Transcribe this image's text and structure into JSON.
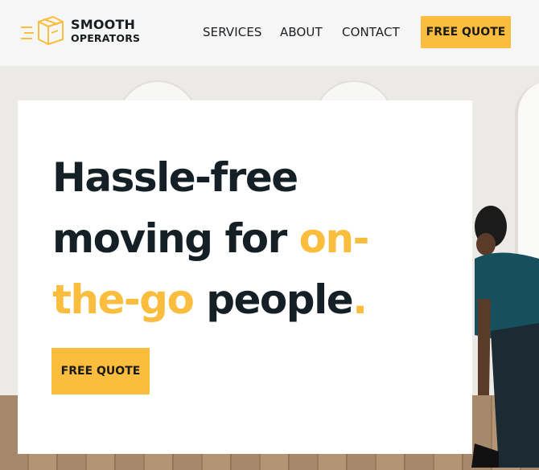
{
  "header": {
    "logo": {
      "line1": "SMOOTH",
      "line2": "OPERATORS",
      "icon": "moving-box-icon"
    },
    "nav": [
      {
        "label": "SERVICES"
      },
      {
        "label": "ABOUT"
      },
      {
        "label": "CONTACT"
      }
    ],
    "cta_label": "FREE QUOTE"
  },
  "hero": {
    "headline": {
      "part1": "Hassle-free",
      "part2": "moving for ",
      "accent1": "on-",
      "accent2": "the-go",
      "part3": " people",
      "period": "."
    },
    "cta_label": "FREE QUOTE"
  },
  "colors": {
    "accent": "#fbbd3d",
    "text_dark": "#142025",
    "header_bg": "#f6f6f6"
  }
}
